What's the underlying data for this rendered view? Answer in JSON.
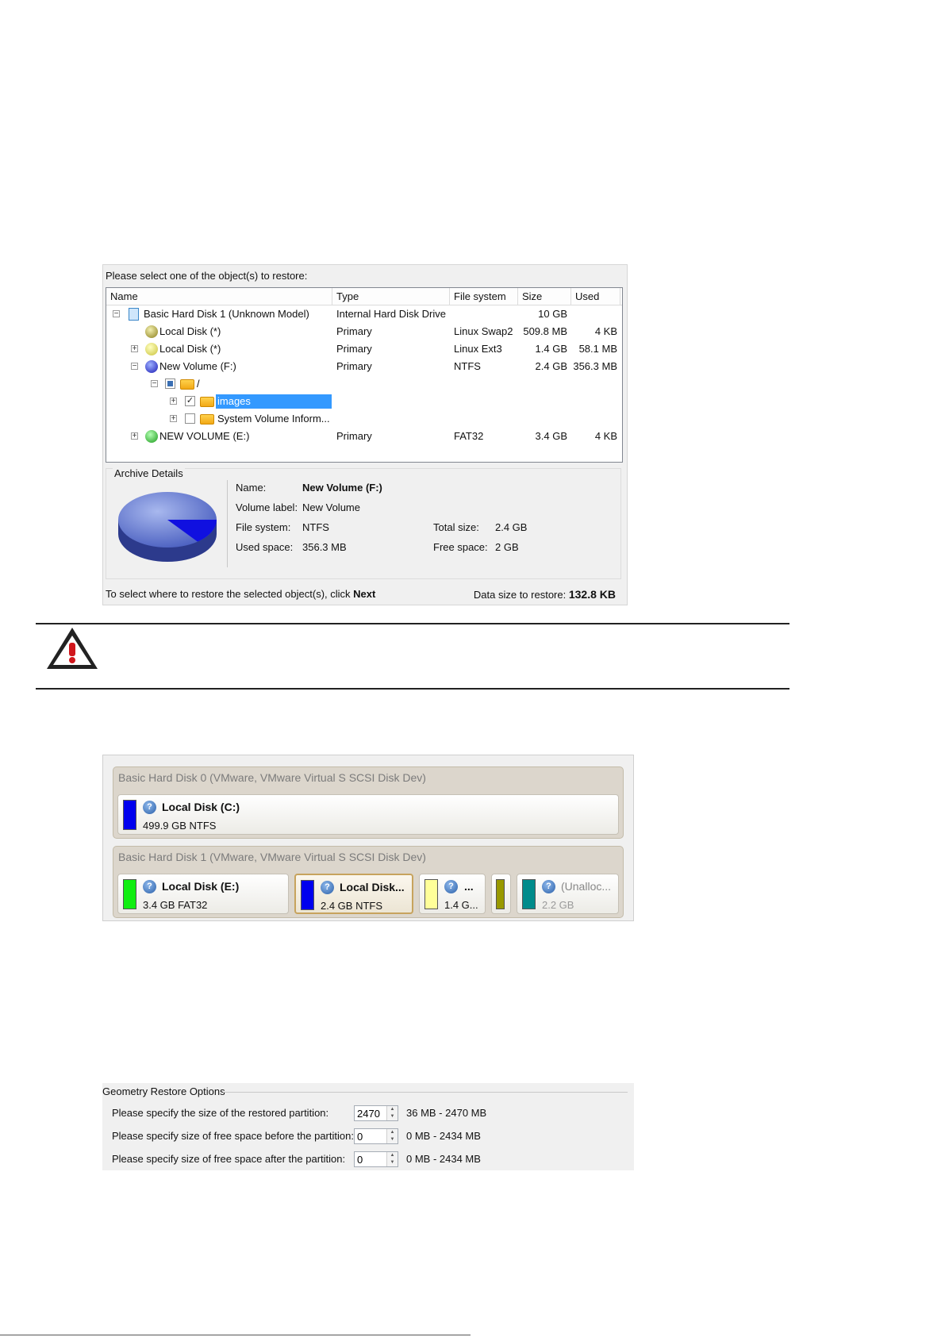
{
  "restore_panel": {
    "title": "Please select one of the object(s) to restore:",
    "columns": [
      "Name",
      "Type",
      "File system",
      "Size",
      "Used"
    ],
    "rows": [
      {
        "name": "Basic Hard Disk 1 (Unknown Model)",
        "type": "Internal Hard Disk Drive",
        "fs": "",
        "size": "10 GB",
        "used": ""
      },
      {
        "name": "Local Disk (*)",
        "type": "Primary",
        "fs": "Linux Swap2",
        "size": "509.8 MB",
        "used": "4 KB"
      },
      {
        "name": "Local Disk (*)",
        "type": "Primary",
        "fs": "Linux Ext3",
        "size": "1.4 GB",
        "used": "58.1 MB"
      },
      {
        "name": "New Volume (F:)",
        "type": "Primary",
        "fs": "NTFS",
        "size": "2.4 GB",
        "used": "356.3 MB"
      },
      {
        "name": "/",
        "type": "",
        "fs": "",
        "size": "",
        "used": ""
      },
      {
        "name": "images",
        "type": "",
        "fs": "",
        "size": "",
        "used": ""
      },
      {
        "name": "System Volume Inform...",
        "type": "",
        "fs": "",
        "size": "",
        "used": ""
      },
      {
        "name": "NEW VOLUME (E:)",
        "type": "Primary",
        "fs": "FAT32",
        "size": "3.4 GB",
        "used": "4 KB"
      }
    ],
    "details": {
      "title": "Archive Details",
      "name_label": "Name:",
      "name_value": "New Volume (F:)",
      "volume_label_label": "Volume label:",
      "volume_label_value": "New Volume",
      "fs_label": "File system:",
      "fs_value": "NTFS",
      "total_label": "Total size:",
      "total_value": "2.4 GB",
      "used_label": "Used space:",
      "used_value": "356.3 MB",
      "free_label": "Free space:",
      "free_value": "2 GB",
      "used_fraction": 0.145
    },
    "footer_text": "To select where to restore the selected object(s), click",
    "footer_next": "Next",
    "data_size_label": "Data size to restore:",
    "data_size_value": "132.8 KB"
  },
  "disk_map": {
    "disk0": {
      "title": "Basic Hard Disk 0 (VMware, VMware Virtual S SCSI Disk Dev)",
      "partitions": [
        {
          "name": "Local Disk (C:)",
          "info": "499.9 GB NTFS",
          "color": "#0000ee"
        }
      ]
    },
    "disk1": {
      "title": "Basic Hard Disk 1 (VMware, VMware Virtual S SCSI Disk Dev)",
      "partitions": [
        {
          "name": "Local Disk (E:)",
          "info": "3.4 GB FAT32",
          "color": "#11ee11"
        },
        {
          "name": "Local Disk...",
          "info": "2.4 GB NTFS",
          "color": "#0000ee"
        },
        {
          "name": "...",
          "info": "1.4 G...",
          "color": "#ffff99"
        },
        {
          "name": "",
          "info": "",
          "color": "#999900"
        },
        {
          "name": "(Unalloc...",
          "info": "2.2 GB",
          "color": "#008b8b"
        }
      ]
    }
  },
  "geometry": {
    "legend": "Geometry Restore Options",
    "rows": [
      {
        "label": "Please specify the size of the restored partition:",
        "value": "2470",
        "range": "36 MB - 2470 MB"
      },
      {
        "label": "Please specify size of free space before the partition:",
        "value": "0",
        "range": "0 MB - 2434 MB"
      },
      {
        "label": "Please specify size of free space after the partition:",
        "value": "0",
        "range": "0 MB - 2434 MB"
      }
    ]
  }
}
